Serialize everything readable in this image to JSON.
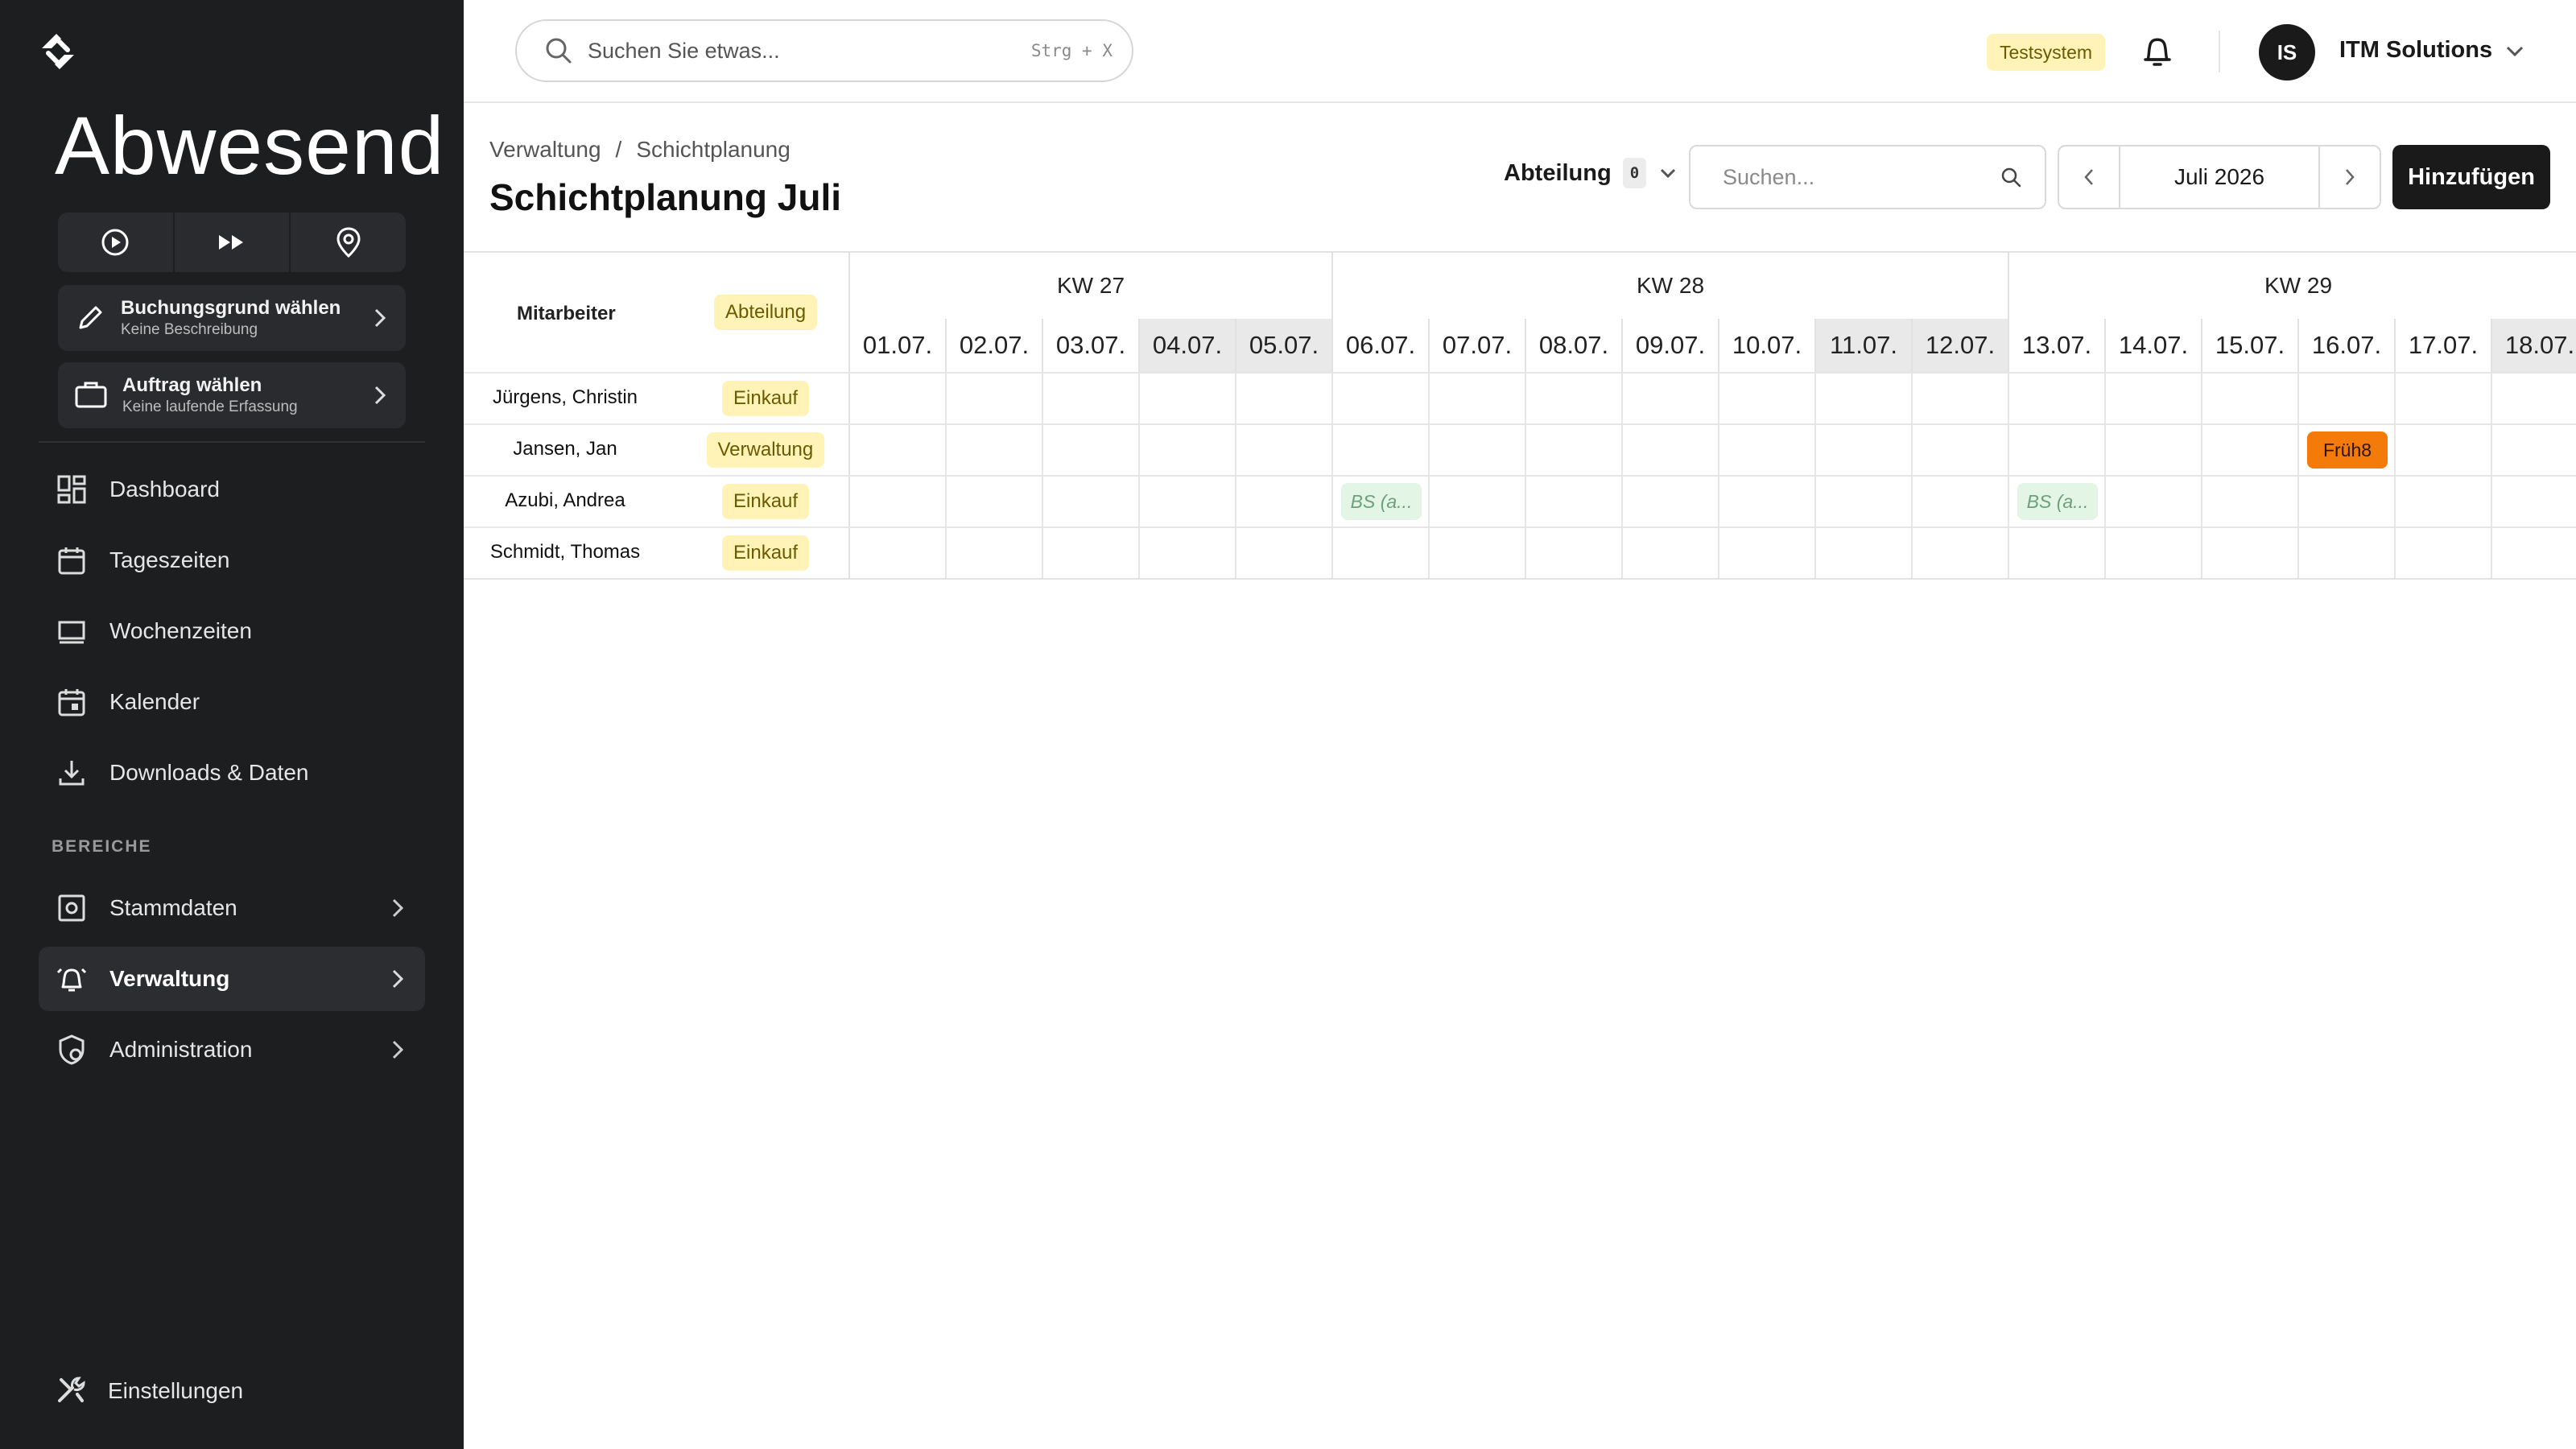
{
  "sidebar": {
    "status_title": "Abwesend",
    "controls": [
      {
        "icon": "play-circle-icon"
      },
      {
        "icon": "fast-forward-icon"
      },
      {
        "icon": "location-pin-icon"
      }
    ],
    "booking_reason": {
      "title": "Buchungsgrund wählen",
      "subtitle": "Keine Beschreibung"
    },
    "order": {
      "title": "Auftrag wählen",
      "subtitle": "Keine laufende Erfassung"
    },
    "nav": [
      {
        "label": "Dashboard",
        "icon": "dashboard-icon"
      },
      {
        "label": "Tageszeiten",
        "icon": "calendar-day-icon"
      },
      {
        "label": "Wochenzeiten",
        "icon": "week-icon"
      },
      {
        "label": "Kalender",
        "icon": "calendar-icon"
      },
      {
        "label": "Downloads & Daten",
        "icon": "download-icon"
      }
    ],
    "section_label": "BEREICHE",
    "areas": [
      {
        "label": "Stammdaten",
        "icon": "settings-box-icon"
      },
      {
        "label": "Verwaltung",
        "icon": "alarm-bell-icon",
        "active": true
      },
      {
        "label": "Administration",
        "icon": "shield-user-icon"
      }
    ],
    "settings_label": "Einstellungen"
  },
  "topbar": {
    "search_placeholder": "Suchen Sie etwas...",
    "search_shortcut": "Strg + X",
    "test_badge": "Testsystem",
    "avatar_initials": "IS",
    "company": "ITM Solutions"
  },
  "header": {
    "breadcrumb": [
      "Verwaltung",
      "Schichtplanung"
    ],
    "breadcrumb_sep": "/",
    "title": "Schichtplanung Juli",
    "dept_label": "Abteilung",
    "dept_count": "0",
    "search_placeholder": "Suchen...",
    "month": "Juli 2026",
    "add_label": "Hinzufügen"
  },
  "grid": {
    "col_employee": "Mitarbeiter",
    "col_department": "Abteilung",
    "weeks": [
      {
        "label": "KW 27",
        "days": 5
      },
      {
        "label": "KW 28",
        "days": 7
      },
      {
        "label": "KW 29",
        "days": 6
      }
    ],
    "days": [
      {
        "label": "01.07.",
        "weekend": false
      },
      {
        "label": "02.07.",
        "weekend": false
      },
      {
        "label": "03.07.",
        "weekend": false
      },
      {
        "label": "04.07.",
        "weekend": true
      },
      {
        "label": "05.07.",
        "weekend": true
      },
      {
        "label": "06.07.",
        "weekend": false
      },
      {
        "label": "07.07.",
        "weekend": false
      },
      {
        "label": "08.07.",
        "weekend": false
      },
      {
        "label": "09.07.",
        "weekend": false
      },
      {
        "label": "10.07.",
        "weekend": false
      },
      {
        "label": "11.07.",
        "weekend": true
      },
      {
        "label": "12.07.",
        "weekend": true
      },
      {
        "label": "13.07.",
        "weekend": false
      },
      {
        "label": "14.07.",
        "weekend": false
      },
      {
        "label": "15.07.",
        "weekend": false
      },
      {
        "label": "16.07.",
        "weekend": false
      },
      {
        "label": "17.07.",
        "weekend": false
      },
      {
        "label": "18.07.",
        "weekend": true
      }
    ],
    "employees": [
      {
        "name": "Jürgens, Christin",
        "department": "Einkauf",
        "shifts": []
      },
      {
        "name": "Jansen, Jan",
        "department": "Verwaltung",
        "shifts": [
          {
            "day": 15,
            "label": "Früh8",
            "style": "orange"
          }
        ]
      },
      {
        "name": "Azubi, Andrea",
        "department": "Einkauf",
        "shifts": [
          {
            "day": 5,
            "label": "BS (a...",
            "style": "green"
          },
          {
            "day": 12,
            "label": "BS (a...",
            "style": "green"
          }
        ]
      },
      {
        "name": "Schmidt, Thomas",
        "department": "Einkauf",
        "shifts": []
      }
    ]
  }
}
